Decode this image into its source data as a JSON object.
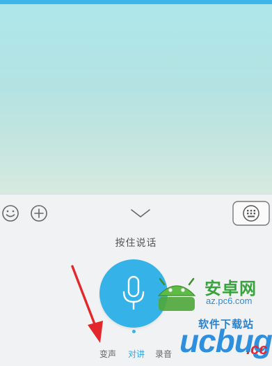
{
  "panel": {
    "hold_to_talk": "按住说话",
    "modes": [
      {
        "label": "变声",
        "selected": false
      },
      {
        "label": "对讲",
        "selected": true
      },
      {
        "label": "录音",
        "selected": false
      }
    ]
  },
  "icons": {
    "emoji": "smiley-icon",
    "plus": "plus-icon",
    "collapse": "chevron-down-icon",
    "keyboard": "keyboard-icon",
    "mic": "microphone-icon"
  },
  "colors": {
    "accent": "#35b3e8",
    "arrow": "#e3282c",
    "watermark_green": "#38a23c",
    "watermark_blue": "#2d8fde"
  },
  "watermark": {
    "title": "安卓网",
    "url": "az.pc6.com",
    "subtitle": "软件下载站",
    "logo_word": "ucbug",
    "logo_suffix": ".cc"
  }
}
